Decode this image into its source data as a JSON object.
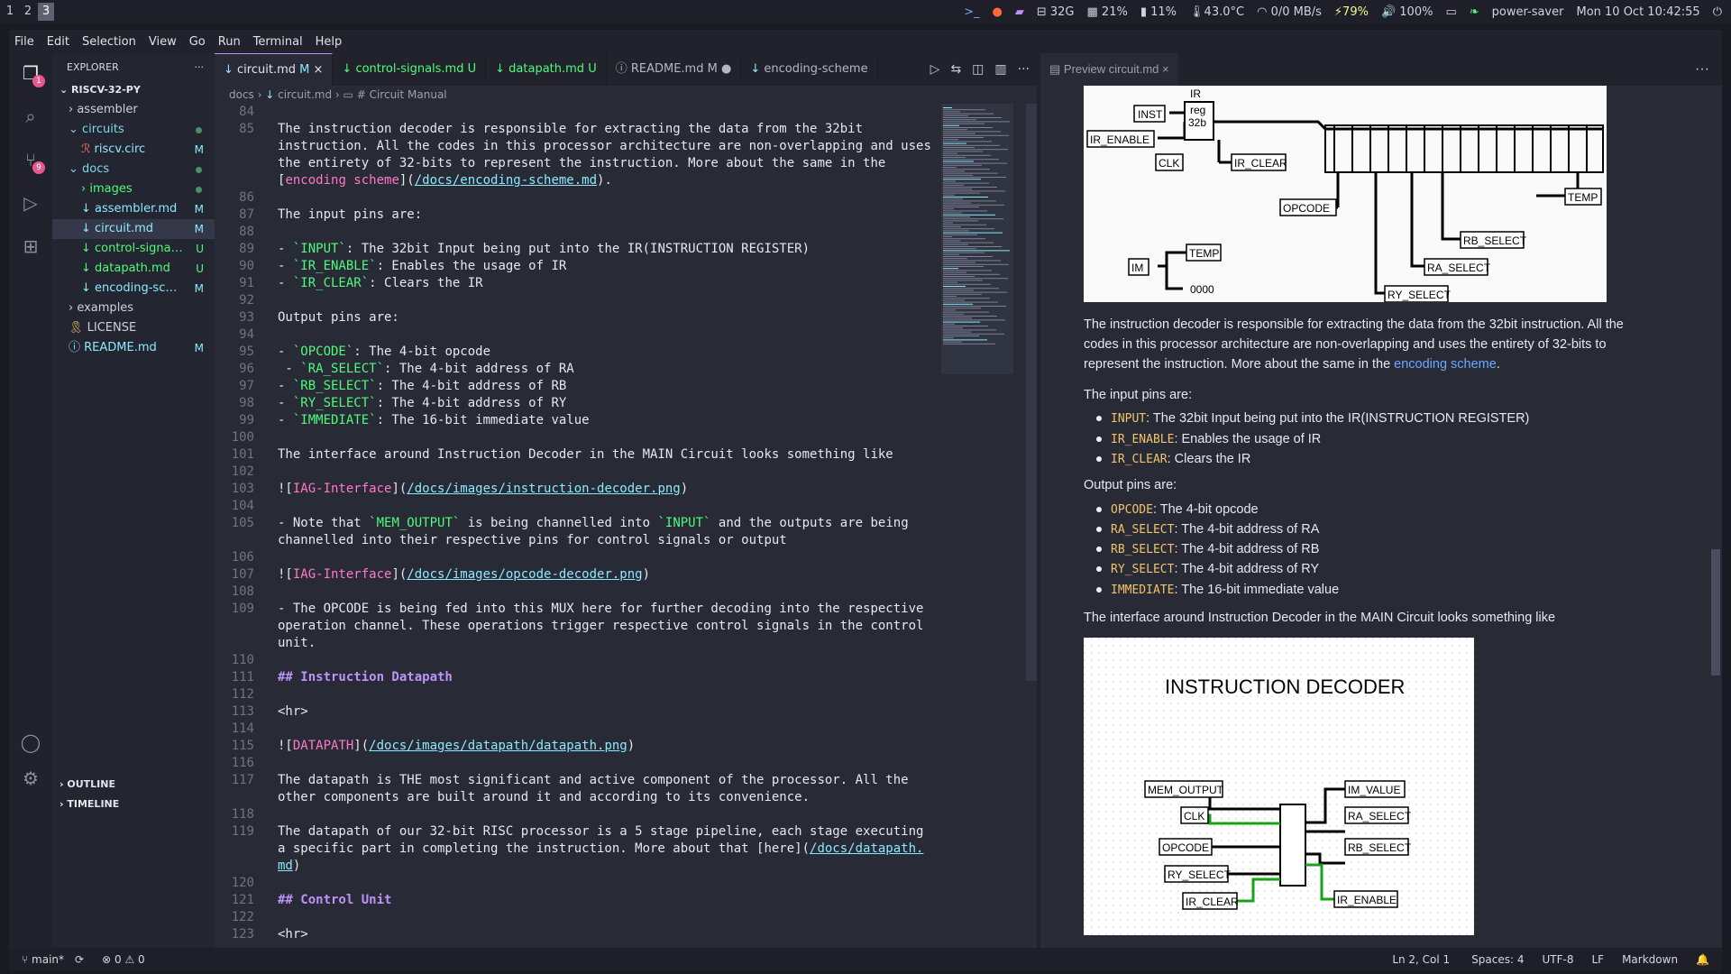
{
  "topbar": {
    "workspaces": [
      "1",
      "2",
      "3"
    ],
    "disk": "32G",
    "mem": "21%",
    "battery_bar": "11%",
    "temp": "43.0°C",
    "net": "0/0 MB/s",
    "charge": "79%",
    "volume": "100%",
    "power_mode": "power-saver",
    "datetime": "Mon 10 Oct 10:42:55"
  },
  "menubar": [
    "File",
    "Edit",
    "Selection",
    "View",
    "Go",
    "Run",
    "Terminal",
    "Help"
  ],
  "activity": {
    "explorer_badge": "1",
    "scm_badge": "9"
  },
  "explorer": {
    "title": "EXPLORER",
    "root": "RISCV-32-PY",
    "items": [
      {
        "label": "assembler",
        "status": ""
      },
      {
        "label": "circuits",
        "status": ""
      },
      {
        "label": "riscv.circ",
        "status": "M"
      },
      {
        "label": "docs",
        "status": ""
      },
      {
        "label": "images",
        "status": ""
      },
      {
        "label": "assembler.md",
        "status": "M"
      },
      {
        "label": "circuit.md",
        "status": "M"
      },
      {
        "label": "control-signal...",
        "status": "U"
      },
      {
        "label": "datapath.md",
        "status": "U"
      },
      {
        "label": "encoding-sch...",
        "status": "M"
      },
      {
        "label": "examples",
        "status": ""
      },
      {
        "label": "LICENSE",
        "status": ""
      },
      {
        "label": "README.md",
        "status": "M"
      }
    ],
    "outline": "OUTLINE",
    "timeline": "TIMELINE"
  },
  "tabs": [
    {
      "label": "circuit.md",
      "status": "M"
    },
    {
      "label": "control-signals.md",
      "status": "U"
    },
    {
      "label": "datapath.md",
      "status": "U"
    },
    {
      "label": "README.md",
      "status": "M"
    },
    {
      "label": "encoding-scheme",
      "status": ""
    }
  ],
  "breadcrumb": {
    "p1": "docs",
    "p2": "circuit.md",
    "p3": "# Circuit Manual"
  },
  "code": [
    {
      "n": "84",
      "t": ""
    },
    {
      "n": "85",
      "t": "The instruction decoder is responsible for extracting the data from the 32bit"
    },
    {
      "n": "",
      "t": "instruction. All the codes in this processor architecture are non-overlapping and uses"
    },
    {
      "n": "",
      "t": "the entirety of 32-bits to represent the instruction. More about the same in the"
    },
    {
      "n": "",
      "t": "[encoding scheme](/docs/encoding-scheme.md)."
    },
    {
      "n": "86",
      "t": ""
    },
    {
      "n": "87",
      "t": "The input pins are:"
    },
    {
      "n": "88",
      "t": ""
    },
    {
      "n": "89",
      "t": "- `INPUT`: The 32bit Input being put into the IR(INSTRUCTION REGISTER)"
    },
    {
      "n": "90",
      "t": "- `IR_ENABLE`: Enables the usage of IR"
    },
    {
      "n": "91",
      "t": "- `IR_CLEAR`: Clears the IR"
    },
    {
      "n": "92",
      "t": ""
    },
    {
      "n": "93",
      "t": "Output pins are:"
    },
    {
      "n": "94",
      "t": ""
    },
    {
      "n": "95",
      "t": "- `OPCODE`: The 4-bit opcode"
    },
    {
      "n": "96",
      "t": " - `RA_SELECT`: The 4-bit address of RA"
    },
    {
      "n": "97",
      "t": "- `RB_SELECT`: The 4-bit address of RB"
    },
    {
      "n": "98",
      "t": "- `RY_SELECT`: The 4-bit address of RY"
    },
    {
      "n": "99",
      "t": "- `IMMEDIATE`: The 16-bit immediate value"
    },
    {
      "n": "100",
      "t": ""
    },
    {
      "n": "101",
      "t": "The interface around Instruction Decoder in the MAIN Circuit looks something like"
    },
    {
      "n": "102",
      "t": ""
    },
    {
      "n": "103",
      "t": "![IAG-Interface](/docs/images/instruction-decoder.png)"
    },
    {
      "n": "104",
      "t": ""
    },
    {
      "n": "105",
      "t": "- Note that `MEM_OUTPUT` is being channelled into `INPUT` and the outputs are being"
    },
    {
      "n": "",
      "t": "channelled into their respective pins for control signals or output"
    },
    {
      "n": "106",
      "t": ""
    },
    {
      "n": "107",
      "t": "![IAG-Interface](/docs/images/opcode-decoder.png)"
    },
    {
      "n": "108",
      "t": ""
    },
    {
      "n": "109",
      "t": "- The OPCODE is being fed into this MUX here for further decoding into the respective"
    },
    {
      "n": "",
      "t": "operation channel. These operations trigger respective control signals in the control"
    },
    {
      "n": "",
      "t": "unit."
    },
    {
      "n": "110",
      "t": ""
    },
    {
      "n": "111",
      "t": "## Instruction Datapath"
    },
    {
      "n": "112",
      "t": ""
    },
    {
      "n": "113",
      "t": "<hr>"
    },
    {
      "n": "114",
      "t": ""
    },
    {
      "n": "115",
      "t": "![DATAPATH](/docs/images/datapath/datapath.png)"
    },
    {
      "n": "116",
      "t": ""
    },
    {
      "n": "117",
      "t": "The datapath is THE most significant and active component of the processor. All the"
    },
    {
      "n": "",
      "t": "other components are built around it and according to its convenience."
    },
    {
      "n": "118",
      "t": ""
    },
    {
      "n": "119",
      "t": "The datapath of our 32-bit RISC processor is a 5 stage pipeline, each stage executing"
    },
    {
      "n": "",
      "t": "a specific part in completing the instruction. More about that [here](/docs/datapath."
    },
    {
      "n": "",
      "t": "md)"
    },
    {
      "n": "120",
      "t": ""
    },
    {
      "n": "121",
      "t": "## Control Unit"
    },
    {
      "n": "122",
      "t": ""
    },
    {
      "n": "123",
      "t": "<hr>"
    }
  ],
  "preview": {
    "tab": "Preview circuit.md",
    "top_image_labels": [
      "IR",
      "reg",
      "32b",
      "INST",
      "IR_ENABLE",
      "CLK",
      "IR_CLEAR",
      "OPCODE",
      "TEMP",
      "RB_SELECT",
      "RA_SELECT",
      "RY_SELECT",
      "IM",
      "TEMP",
      "0000"
    ],
    "para1_a": "The instruction decoder is responsible for extracting the data from the 32bit instruction. All the codes in this processor architecture are non-overlapping and uses the entirety of 32-bits to represent the instruction. More about the same in the ",
    "para1_link": "encoding scheme",
    "para1_b": ".",
    "input_heading": "The input pins are:",
    "inputs": [
      {
        "code": "INPUT",
        "text": ": The 32bit Input being put into the IR(INSTRUCTION REGISTER)"
      },
      {
        "code": "IR_ENABLE",
        "text": ": Enables the usage of IR"
      },
      {
        "code": "IR_CLEAR",
        "text": ": Clears the IR"
      }
    ],
    "output_heading": "Output pins are:",
    "outputs": [
      {
        "code": "OPCODE",
        "text": ": The 4-bit opcode"
      },
      {
        "code": "RA_SELECT",
        "text": ": The 4-bit address of RA"
      },
      {
        "code": "RB_SELECT",
        "text": ": The 4-bit address of RB"
      },
      {
        "code": "RY_SELECT",
        "text": ": The 4-bit address of RY"
      },
      {
        "code": "IMMEDIATE",
        "text": ": The 16-bit immediate value"
      }
    ],
    "interface_text": "The interface around Instruction Decoder in the MAIN Circuit looks something like",
    "decoder_title": "INSTRUCTION DECODER",
    "decoder_left": [
      "MEM_OUTPUT",
      "CLK",
      "OPCODE",
      "RY_SELECT",
      "IR_CLEAR"
    ],
    "decoder_right": [
      "IM_VALUE",
      "RA_SELECT",
      "RB_SELECT",
      "IR_ENABLE"
    ]
  },
  "statusbar": {
    "branch": "main*",
    "errors": "0",
    "warnings": "0",
    "position": "Ln 2, Col 1",
    "spaces": "Spaces: 4",
    "encoding": "UTF-8",
    "eol": "LF",
    "language": "Markdown"
  }
}
